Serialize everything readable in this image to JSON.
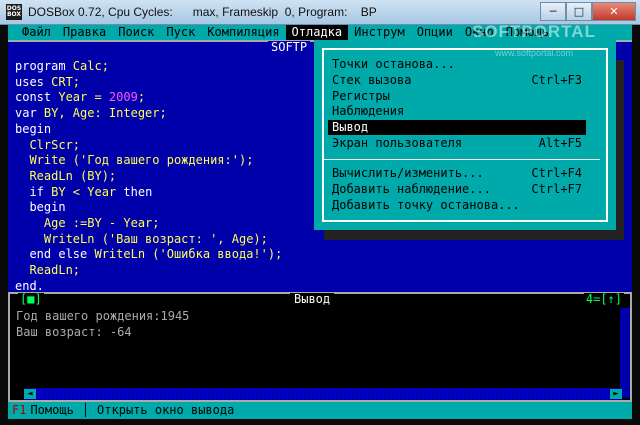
{
  "window": {
    "title": "DOSBox 0.72, Cpu Cycles:      max, Frameskip  0, Program:    BP",
    "minimize": "─",
    "maximize": "□",
    "close": "✕"
  },
  "menubar": {
    "items": [
      {
        "label": "Файл"
      },
      {
        "label": "Правка"
      },
      {
        "label": "Поиск"
      },
      {
        "label": "Пуск"
      },
      {
        "label": "Компиляция"
      },
      {
        "label": "Отладка"
      },
      {
        "label": "Инструм"
      },
      {
        "label": "Опции"
      },
      {
        "label": "Окно"
      },
      {
        "label": "Помощь"
      }
    ]
  },
  "editor": {
    "title": "SOFTP"
  },
  "code": [
    [
      {
        "t": "program",
        "c": "kw"
      },
      {
        "t": " Calc;",
        "c": "id"
      }
    ],
    [
      {
        "t": "uses",
        "c": "kw"
      },
      {
        "t": " CRT;",
        "c": "id"
      }
    ],
    [
      {
        "t": "const",
        "c": "kw"
      },
      {
        "t": " Year = ",
        "c": "id"
      },
      {
        "t": "2009",
        "c": "num"
      },
      {
        "t": ";",
        "c": "id"
      }
    ],
    [
      {
        "t": "var",
        "c": "kw"
      },
      {
        "t": " BY, Age: Integer;",
        "c": "id"
      }
    ],
    [
      {
        "t": "begin",
        "c": "kw"
      }
    ],
    [
      {
        "t": "  ClrScr;",
        "c": "id"
      }
    ],
    [
      {
        "t": "  Write (",
        "c": "id"
      },
      {
        "t": "'Год вашего рождения:'",
        "c": "str"
      },
      {
        "t": ");",
        "c": "id"
      }
    ],
    [
      {
        "t": "  ReadLn (BY);",
        "c": "id"
      }
    ],
    [
      {
        "t": "  ",
        "c": "id"
      },
      {
        "t": "if",
        "c": "kw"
      },
      {
        "t": " BY < Year ",
        "c": "id"
      },
      {
        "t": "then",
        "c": "kw"
      }
    ],
    [
      {
        "t": "  ",
        "c": "id"
      },
      {
        "t": "begin",
        "c": "kw"
      }
    ],
    [
      {
        "t": "    Age :=BY - Year;",
        "c": "id"
      }
    ],
    [
      {
        "t": "    WriteLn (",
        "c": "id"
      },
      {
        "t": "'Ваш возраст: '",
        "c": "str"
      },
      {
        "t": ", Age);",
        "c": "id"
      }
    ],
    [
      {
        "t": "  ",
        "c": "id"
      },
      {
        "t": "end else",
        "c": "kw"
      },
      {
        "t": " WriteLn (",
        "c": "id"
      },
      {
        "t": "'Ошибка ввода!'",
        "c": "str"
      },
      {
        "t": ");",
        "c": "id"
      }
    ],
    [
      {
        "t": "  ReadLn;",
        "c": "id"
      }
    ],
    [
      {
        "t": "end.",
        "c": "kw"
      }
    ]
  ],
  "dropdown": {
    "items": [
      {
        "label": "Точки останова...",
        "shortcut": ""
      },
      {
        "label": "Стек вызова",
        "shortcut": "Ctrl+F3"
      },
      {
        "label": "Регистры",
        "shortcut": ""
      },
      {
        "label": "Наблюдения",
        "shortcut": ""
      },
      {
        "label": "Вывод",
        "shortcut": "",
        "selected": true
      },
      {
        "label": "Экран пользователя",
        "shortcut": "Alt+F5"
      }
    ],
    "items2": [
      {
        "label": "Вычислить/изменить...",
        "shortcut": "Ctrl+F4"
      },
      {
        "label": "Добавить наблюдение...",
        "shortcut": "Ctrl+F7"
      },
      {
        "label": "Добавить точку останова...",
        "shortcut": ""
      }
    ]
  },
  "output": {
    "title": "Вывод",
    "left_marker": "[■]",
    "right_marker": "4=[↑]",
    "lines": [
      "Год вашего рождения:1945",
      "Ваш возраст: -64"
    ]
  },
  "status": {
    "key": "F1",
    "help": "Помощь",
    "hint": "Открыть окно вывода"
  },
  "watermark": {
    "text": "SOFTPORTAL",
    "sub": "www.softportal.com"
  }
}
